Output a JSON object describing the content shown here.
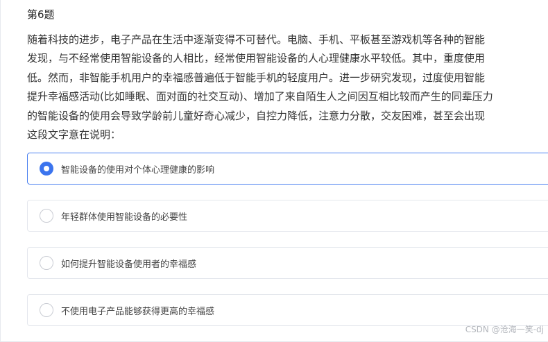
{
  "question": {
    "title": "第6题",
    "stem_lines": [
      "随着科技的进步，电子产品在生活中逐渐变得不可替代。电脑、手机、平板甚至游戏机等各种的智能",
      "发现，与不经常使用智能设备的人相比，经常使用智能设备的人心理健康水平较低。其中，重度使用",
      "低。然而，非智能手机用户的幸福感普遍低于智能手机的轻度用户。进一步研究发现，过度使用智能",
      "提升幸福感活动(比如睡眠、面对面的社交互动)、增加了来自陌生人之间因互相比较而产生的同辈压力",
      "的智能设备的使用会导致学龄前儿童好奇心减少，自控力降低，注意力分散，交友困难，甚至会出现",
      "这段文字意在说明："
    ]
  },
  "options": [
    {
      "label": "智能设备的使用对个体心理健康的影响",
      "selected": true
    },
    {
      "label": "年轻群体使用智能设备的必要性",
      "selected": false
    },
    {
      "label": "如何提升智能设备使用者的幸福感",
      "selected": false
    },
    {
      "label": "不使用电子产品能够获得更高的幸福感",
      "selected": false
    }
  ],
  "watermark": "CSDN @沧海一笑-dj",
  "colors": {
    "accent": "#3b74ee",
    "selected_border": "#4a80f0",
    "option_border": "#e4e7ed",
    "text": "#333333",
    "watermark": "#b3b6bc"
  }
}
